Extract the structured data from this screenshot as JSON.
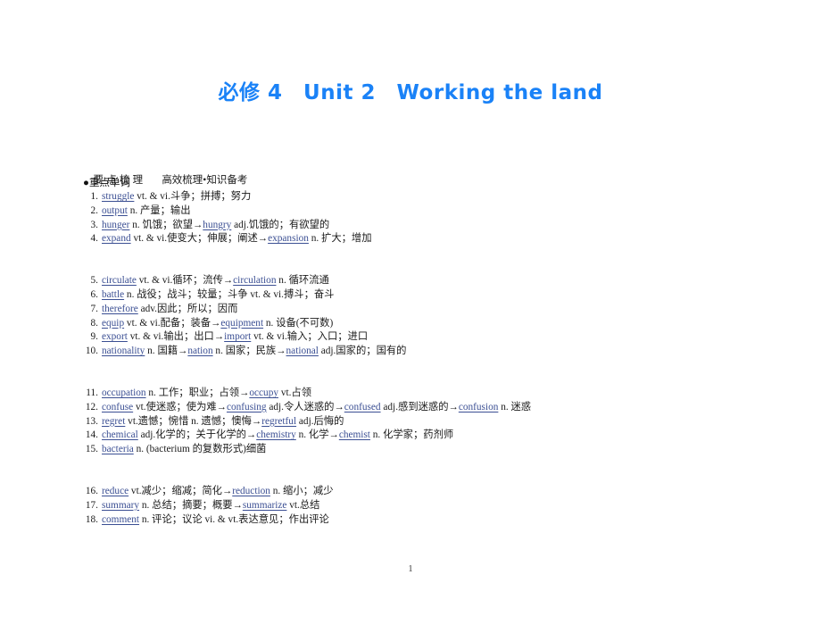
{
  "title": "必修 4　Unit 2　Working the land",
  "section": {
    "label": "要点梳理",
    "subtitle": "高效梳理•知识备考",
    "subsection": "●重点单词"
  },
  "page_number": "1",
  "colors": {
    "title_blue": "#1a82f7",
    "headword_blue": "#3b4f93",
    "body_black": "#1a1a1a",
    "page_background": "#ffffff"
  },
  "groups": [
    {
      "entries": [
        {
          "num": "1.",
          "parts": [
            {
              "t": "hw",
              "s": "struggle"
            },
            {
              "t": "plain",
              "s": " vt. & vi."
            },
            {
              "t": "plain",
              "s": "斗争；拼搏；努力"
            }
          ]
        },
        {
          "num": "2.",
          "parts": [
            {
              "t": "hw",
              "s": "output"
            },
            {
              "t": "plain",
              "s": " n. "
            },
            {
              "t": "plain",
              "s": "产量；输出"
            }
          ]
        },
        {
          "num": "3.",
          "parts": [
            {
              "t": "hw",
              "s": "hunger"
            },
            {
              "t": "plain",
              "s": " n. "
            },
            {
              "t": "plain",
              "s": "饥饿；欲望"
            },
            {
              "t": "arrow",
              "s": "→"
            },
            {
              "t": "hw",
              "s": "hungry"
            },
            {
              "t": "plain",
              "s": " adj."
            },
            {
              "t": "plain",
              "s": "饥饿的；有欲望的"
            }
          ]
        },
        {
          "num": "4.",
          "parts": [
            {
              "t": "hw",
              "s": "expand"
            },
            {
              "t": "plain",
              "s": " vt. & vi."
            },
            {
              "t": "plain",
              "s": "使变大；伸展；阐述"
            },
            {
              "t": "arrow",
              "s": "→"
            },
            {
              "t": "hw",
              "s": "expansion"
            },
            {
              "t": "plain",
              "s": " n. "
            },
            {
              "t": "plain",
              "s": "扩大；增加"
            }
          ]
        }
      ]
    },
    {
      "entries": [
        {
          "num": "5.",
          "parts": [
            {
              "t": "hw",
              "s": "circulate"
            },
            {
              "t": "plain",
              "s": " vt. & vi."
            },
            {
              "t": "plain",
              "s": "循环；流传"
            },
            {
              "t": "arrow",
              "s": "→"
            },
            {
              "t": "hw",
              "s": "circulation"
            },
            {
              "t": "plain",
              "s": " n. "
            },
            {
              "t": "plain",
              "s": "循环流通"
            }
          ]
        },
        {
          "num": "6.",
          "parts": [
            {
              "t": "hw",
              "s": "battle"
            },
            {
              "t": "plain",
              "s": " n. "
            },
            {
              "t": "plain",
              "s": "战役；战斗；较量；斗争"
            },
            {
              "t": "plain",
              "s": " vt. & vi."
            },
            {
              "t": "plain",
              "s": "搏斗；奋斗"
            }
          ]
        },
        {
          "num": "7.",
          "parts": [
            {
              "t": "hw",
              "s": "therefore"
            },
            {
              "t": "plain",
              "s": " adv."
            },
            {
              "t": "plain",
              "s": "因此；所以；因而"
            }
          ]
        },
        {
          "num": "8.",
          "parts": [
            {
              "t": "hw",
              "s": "equip"
            },
            {
              "t": "plain",
              "s": " vt. & vi."
            },
            {
              "t": "plain",
              "s": "配备；装备"
            },
            {
              "t": "arrow",
              "s": "→"
            },
            {
              "t": "hw",
              "s": "equipment"
            },
            {
              "t": "plain",
              "s": " n. "
            },
            {
              "t": "plain",
              "s": "设备(不可数)"
            }
          ]
        },
        {
          "num": "9.",
          "parts": [
            {
              "t": "hw",
              "s": "export"
            },
            {
              "t": "plain",
              "s": " vt. & vi."
            },
            {
              "t": "plain",
              "s": "输出；出口"
            },
            {
              "t": "arrow",
              "s": "→"
            },
            {
              "t": "hw",
              "s": "import"
            },
            {
              "t": "plain",
              "s": " vt. & vi."
            },
            {
              "t": "plain",
              "s": "输入；入口；进口"
            }
          ]
        },
        {
          "num": "10.",
          "parts": [
            {
              "t": "hw",
              "s": "nationality"
            },
            {
              "t": "plain",
              "s": " n. "
            },
            {
              "t": "plain",
              "s": "国籍"
            },
            {
              "t": "arrow",
              "s": "→"
            },
            {
              "t": "hw",
              "s": "nation"
            },
            {
              "t": "plain",
              "s": " n. "
            },
            {
              "t": "plain",
              "s": "国家；民族"
            },
            {
              "t": "arrow",
              "s": "→"
            },
            {
              "t": "hw",
              "s": "national"
            },
            {
              "t": "plain",
              "s": " adj."
            },
            {
              "t": "plain",
              "s": "国家的；国有的"
            }
          ]
        }
      ]
    },
    {
      "entries": [
        {
          "num": "11.",
          "parts": [
            {
              "t": "hw",
              "s": "occupation"
            },
            {
              "t": "plain",
              "s": " n. "
            },
            {
              "t": "plain",
              "s": "工作；职业；占领"
            },
            {
              "t": "arrow",
              "s": "→"
            },
            {
              "t": "hw",
              "s": "occupy"
            },
            {
              "t": "plain",
              "s": " vt."
            },
            {
              "t": "plain",
              "s": "占领"
            }
          ]
        },
        {
          "num": "12.",
          "parts": [
            {
              "t": "hw",
              "s": "confuse"
            },
            {
              "t": "plain",
              "s": " vt."
            },
            {
              "t": "plain",
              "s": "使迷惑；使为难"
            },
            {
              "t": "arrow",
              "s": "→"
            },
            {
              "t": "hw",
              "s": "confusing"
            },
            {
              "t": "plain",
              "s": " adj."
            },
            {
              "t": "plain",
              "s": "令人迷惑的"
            },
            {
              "t": "arrow",
              "s": "→"
            },
            {
              "t": "hw",
              "s": "confused"
            },
            {
              "t": "plain",
              "s": " adj."
            },
            {
              "t": "plain",
              "s": "感到迷惑的"
            },
            {
              "t": "arrow",
              "s": "→"
            },
            {
              "t": "hw",
              "s": "confusion"
            },
            {
              "t": "plain",
              "s": " n. "
            },
            {
              "t": "plain",
              "s": "迷惑"
            }
          ]
        },
        {
          "num": "13.",
          "parts": [
            {
              "t": "hw",
              "s": "regret"
            },
            {
              "t": "plain",
              "s": " vt."
            },
            {
              "t": "plain",
              "s": "遗憾；惋惜"
            },
            {
              "t": "plain",
              "s": " n. "
            },
            {
              "t": "plain",
              "s": "遗憾；懊悔"
            },
            {
              "t": "arrow",
              "s": "→"
            },
            {
              "t": "hw",
              "s": "regretful"
            },
            {
              "t": "plain",
              "s": " adj."
            },
            {
              "t": "plain",
              "s": "后悔的"
            }
          ]
        },
        {
          "num": "14.",
          "parts": [
            {
              "t": "hw",
              "s": "chemical"
            },
            {
              "t": "plain",
              "s": " adj."
            },
            {
              "t": "plain",
              "s": "化学的；关于化学的"
            },
            {
              "t": "arrow",
              "s": "→"
            },
            {
              "t": "hw",
              "s": "chemistry"
            },
            {
              "t": "plain",
              "s": " n. "
            },
            {
              "t": "plain",
              "s": "化学"
            },
            {
              "t": "arrow",
              "s": "→"
            },
            {
              "t": "hw",
              "s": "chemist"
            },
            {
              "t": "plain",
              "s": " n. "
            },
            {
              "t": "plain",
              "s": "化学家；药剂师"
            }
          ]
        },
        {
          "num": "15.",
          "parts": [
            {
              "t": "hw",
              "s": "bacteria"
            },
            {
              "t": "plain",
              "s": " n. "
            },
            {
              "t": "plain",
              "s": "(bacterium 的复数形式)细菌"
            }
          ]
        }
      ]
    },
    {
      "entries": [
        {
          "num": "16.",
          "parts": [
            {
              "t": "hw",
              "s": "reduce"
            },
            {
              "t": "plain",
              "s": " vt."
            },
            {
              "t": "plain",
              "s": "减少；缩减；简化"
            },
            {
              "t": "arrow",
              "s": "→"
            },
            {
              "t": "hw",
              "s": "reduction"
            },
            {
              "t": "plain",
              "s": " n. "
            },
            {
              "t": "plain",
              "s": "缩小；减少"
            }
          ]
        },
        {
          "num": "17.",
          "parts": [
            {
              "t": "hw",
              "s": "summary"
            },
            {
              "t": "plain",
              "s": " n. "
            },
            {
              "t": "plain",
              "s": "总结；摘要；概要"
            },
            {
              "t": "arrow",
              "s": "→"
            },
            {
              "t": "hw",
              "s": "summarize"
            },
            {
              "t": "plain",
              "s": " vt."
            },
            {
              "t": "plain",
              "s": "总结"
            }
          ]
        },
        {
          "num": "18.",
          "parts": [
            {
              "t": "hw",
              "s": "comment"
            },
            {
              "t": "plain",
              "s": " n. "
            },
            {
              "t": "plain",
              "s": "评论；议论"
            },
            {
              "t": "plain",
              "s": " vi. & vt."
            },
            {
              "t": "plain",
              "s": "表达意见；作出评论"
            }
          ]
        }
      ]
    }
  ]
}
